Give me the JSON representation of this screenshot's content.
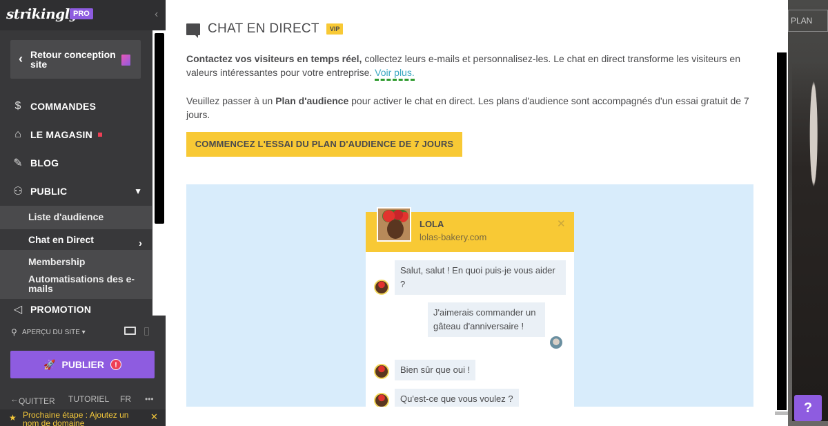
{
  "sidebar": {
    "logo": "strikingly",
    "pro_badge": "PRO",
    "back_label": "Retour conception site",
    "nav": [
      {
        "label": "COMMANDES",
        "icon": "dollar-circle-icon"
      },
      {
        "label": "LE MAGASIN",
        "icon": "store-icon"
      },
      {
        "label": "BLOG",
        "icon": "pen-icon"
      },
      {
        "label": "PUBLIC",
        "icon": "people-icon"
      }
    ],
    "sub_items": [
      {
        "label": "Liste d'audience"
      },
      {
        "label": "Chat en Direct",
        "active": true
      },
      {
        "label": "Membership"
      },
      {
        "label": "Automatisations des e-mails"
      }
    ],
    "promotion_label": "PROMOTION",
    "preview_label": "APERÇU DU SITE",
    "publish_label": "PUBLIER",
    "footer": {
      "quit": "QUITTER",
      "tutorial": "TUTORIEL",
      "lang": "FR",
      "more": "•••"
    },
    "next_step": "Prochaine étape : Ajoutez un nom de domaine"
  },
  "main": {
    "title": "CHAT EN DIRECT",
    "badge": "VIP",
    "intro_bold": "Contactez vos visiteurs en temps réel,",
    "intro_rest": " collectez leurs e-mails et personnalisez-les. Le chat en direct transforme les visiteurs en valeurs intéressantes pour votre entreprise. ",
    "intro_link": "Voir plus.",
    "upgrade_pre": "Veuillez passer à un ",
    "upgrade_bold": "Plan d'audience",
    "upgrade_post": " pour activer le chat en direct. Les plans d'audience sont accompagnés d'un essai gratuit de 7 jours.",
    "cta_label": "COMMENCEZ L'ESSAI DU PLAN D'AUDIENCE DE 7 JOURS"
  },
  "chat_preview": {
    "name": "LOLA",
    "site": "lolas-bakery.com",
    "messages": [
      {
        "from": "agent",
        "text": "Salut, salut ! En quoi puis-je vous aider ?"
      },
      {
        "from": "visitor",
        "text": "J'aimerais commander un gâteau d'anniversaire !"
      },
      {
        "from": "agent",
        "text": "Bien sûr que oui !"
      },
      {
        "from": "agent",
        "text": "Qu'est-ce que vous voulez ?"
      }
    ]
  },
  "right": {
    "plan_label": "PLAN",
    "help_label": "?"
  },
  "colors": {
    "accent": "#8e5ce0",
    "yellow": "#f8c935",
    "sidebar": "#38383a",
    "preview_bg": "#d8ecfb",
    "red": "#ee3f55"
  }
}
